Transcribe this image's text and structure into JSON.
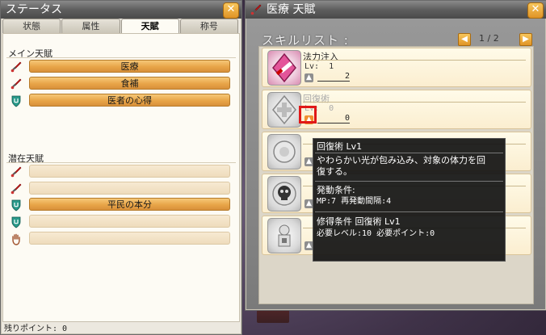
{
  "status_window": {
    "title": "ステータス",
    "tabs": [
      "状態",
      "属性",
      "天賦",
      "称号"
    ],
    "active_tab": "天賦",
    "main_section_title": "メイン天賦",
    "main_talents": [
      "医療",
      "食補",
      "医者の心得"
    ],
    "latent_section_title": "潜在天賦",
    "latent_talents": [
      "",
      "",
      "平民の本分",
      "",
      ""
    ],
    "remaining_points": "残りポイント: 0"
  },
  "medical_window": {
    "title": "医療 天賦",
    "skill_list_label": "スキルリスト :",
    "page": "1 / 2",
    "skills": [
      {
        "name": "法力注入",
        "lv_label": "Lv:",
        "lv_value": "1",
        "points": "2"
      },
      {
        "name": "回復術",
        "lv_label": "Lv:",
        "lv_value": "0",
        "points": "0"
      }
    ]
  },
  "tooltip": {
    "title": "回復術 Lv1",
    "description_line1": "やわらかい光が包み込み、対象の体力を回",
    "description_line2": "復する。",
    "activation_title": "発動条件:",
    "activation_detail": "MP:7 再発動間隔:4",
    "learn_title": "修得条件 回復術 Lv1",
    "learn_detail": "必要レベル:10  必要ポイント:0"
  },
  "icons": {
    "close": "close-icon",
    "sword": "sword-icon",
    "shield": "shield-icon",
    "hand": "hand-icon",
    "up_arrow": "up-arrow-icon"
  },
  "colors": {
    "accent_orange": "#e8a548",
    "close_orange": "#e09426",
    "highlight_red": "#e01818"
  }
}
